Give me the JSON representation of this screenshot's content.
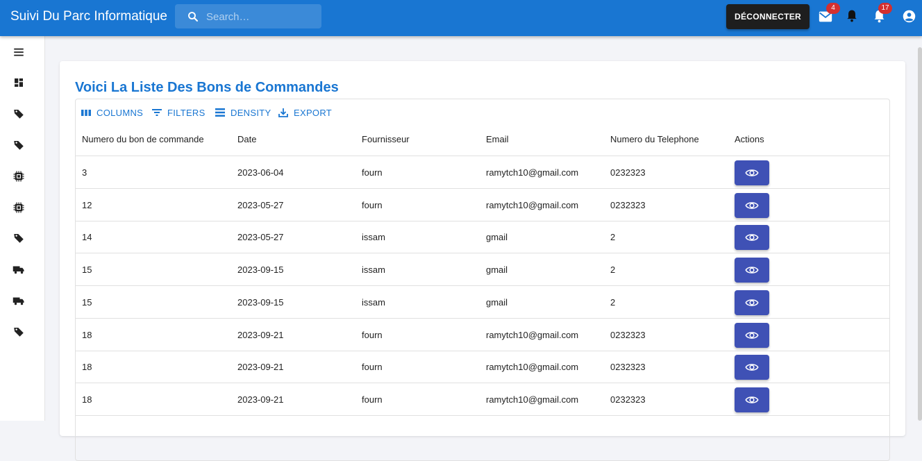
{
  "appbar": {
    "title": "Suivi Du Parc Informatique",
    "search_placeholder": "Search…",
    "logout_label": "DÉCONNECTER",
    "mail_count": "4",
    "notif_count": "17"
  },
  "sidebar": {
    "icons": [
      "menu-icon",
      "dashboard-icon",
      "tag-icon",
      "tag-icon",
      "chip-icon",
      "chip-icon",
      "tag-icon",
      "truck-icon",
      "truck-icon",
      "tag-icon"
    ]
  },
  "main": {
    "title": "Voici La Liste Des Bons de Commandes",
    "toolbar": {
      "columns": "COLUMNS",
      "filters": "FILTERS",
      "density": "DENSITY",
      "export": "EXPORT"
    },
    "columns": [
      "Numero du bon de commande",
      "Date",
      "Fournisseur",
      "Email",
      "Numero du Telephone",
      "Actions"
    ],
    "rows": [
      [
        "3",
        "2023-06-04",
        "fourn",
        "ramytch10@gmail.com",
        "0232323"
      ],
      [
        "12",
        "2023-05-27",
        "fourn",
        "ramytch10@gmail.com",
        "0232323"
      ],
      [
        "14",
        "2023-05-27",
        "issam",
        "gmail",
        "2"
      ],
      [
        "15",
        "2023-09-15",
        "issam",
        "gmail",
        "2"
      ],
      [
        "15",
        "2023-09-15",
        "issam",
        "gmail",
        "2"
      ],
      [
        "18",
        "2023-09-21",
        "fourn",
        "ramytch10@gmail.com",
        "0232323"
      ],
      [
        "18",
        "2023-09-21",
        "fourn",
        "ramytch10@gmail.com",
        "0232323"
      ],
      [
        "18",
        "2023-09-21",
        "fourn",
        "ramytch10@gmail.com",
        "0232323"
      ]
    ]
  },
  "colors": {
    "primary": "#1976d2",
    "action_button": "#3f51b5",
    "badge": "#d32f2f"
  }
}
